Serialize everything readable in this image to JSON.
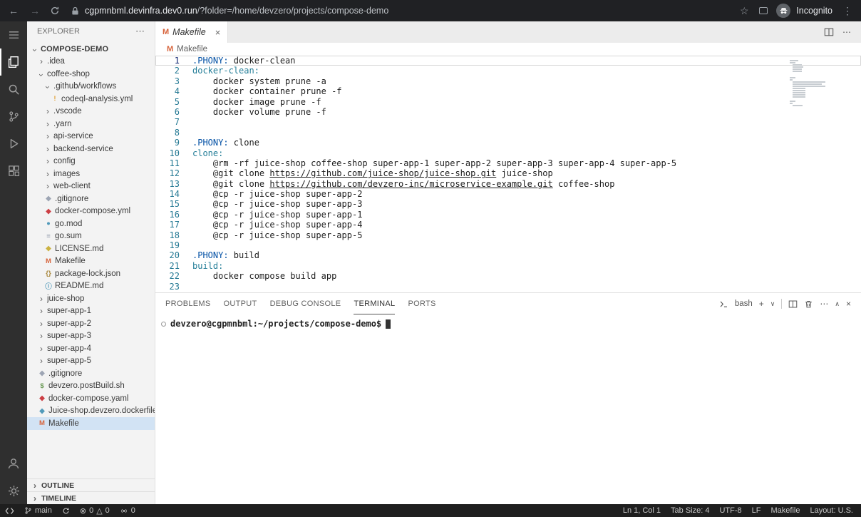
{
  "browser": {
    "url_host": "cgpmnbml.devinfra.dev0.run",
    "url_path": "/?folder=/home/devzero/projects/compose-demo",
    "incognito_label": "Incognito"
  },
  "colors": {
    "makefile_icon": "#d7643c",
    "docker_red": "#cc3e44",
    "docker_blue": "#519aba",
    "selection_background": "#d2e3f4",
    "status_bar_background": "#1f1f1f",
    "keyword": "#0451a5",
    "target": "#267f99"
  },
  "icons": {
    "warning": "!",
    "git": "◆",
    "docker": "◆",
    "dockerfile": "◆",
    "go": "●",
    "gosum": "≡",
    "license": "◆",
    "makefile": "M",
    "json": "{}",
    "info": "ⓘ",
    "shell": "$"
  },
  "sidebar": {
    "header": "EXPLORER",
    "sections": {
      "outline": "OUTLINE",
      "timeline": "TIMELINE"
    },
    "tree": [
      {
        "label": "COMPOSE-DEMO",
        "level": 0,
        "type": "root",
        "expanded": true
      },
      {
        "label": ".idea",
        "level": 1,
        "type": "folder",
        "expanded": false
      },
      {
        "label": "coffee-shop",
        "level": 1,
        "type": "folder",
        "expanded": true
      },
      {
        "label": ".github/workflows",
        "level": 2,
        "type": "folder",
        "expanded": true
      },
      {
        "label": "codeql-analysis.yml",
        "level": 3,
        "type": "file",
        "icon": "warning",
        "color": "#e2a33d"
      },
      {
        "label": ".vscode",
        "level": 2,
        "type": "folder",
        "expanded": false
      },
      {
        "label": ".yarn",
        "level": 2,
        "type": "folder",
        "expanded": false
      },
      {
        "label": "api-service",
        "level": 2,
        "type": "folder",
        "expanded": false
      },
      {
        "label": "backend-service",
        "level": 2,
        "type": "folder",
        "expanded": false
      },
      {
        "label": "config",
        "level": 2,
        "type": "folder",
        "expanded": false
      },
      {
        "label": "images",
        "level": 2,
        "type": "folder",
        "expanded": false
      },
      {
        "label": "web-client",
        "level": 2,
        "type": "folder",
        "expanded": false
      },
      {
        "label": ".gitignore",
        "level": 2,
        "type": "file",
        "icon": "git",
        "color": "#9da5b4"
      },
      {
        "label": "docker-compose.yml",
        "level": 2,
        "type": "file",
        "icon": "docker",
        "color": "#cc3e44"
      },
      {
        "label": "go.mod",
        "level": 2,
        "type": "file",
        "icon": "go",
        "color": "#519aba"
      },
      {
        "label": "go.sum",
        "level": 2,
        "type": "file",
        "icon": "gosum",
        "color": "#9da5b4"
      },
      {
        "label": "LICENSE.md",
        "level": 2,
        "type": "file",
        "icon": "license",
        "color": "#cbb241"
      },
      {
        "label": "Makefile",
        "level": 2,
        "type": "file",
        "icon": "makefile",
        "color": "#d7643c"
      },
      {
        "label": "package-lock.json",
        "level": 2,
        "type": "file",
        "icon": "json",
        "color": "#a8863a"
      },
      {
        "label": "README.md",
        "level": 2,
        "type": "file",
        "icon": "info",
        "color": "#519aba"
      },
      {
        "label": "juice-shop",
        "level": 1,
        "type": "folder",
        "expanded": false
      },
      {
        "label": "super-app-1",
        "level": 1,
        "type": "folder",
        "expanded": false
      },
      {
        "label": "super-app-2",
        "level": 1,
        "type": "folder",
        "expanded": false
      },
      {
        "label": "super-app-3",
        "level": 1,
        "type": "folder",
        "expanded": false
      },
      {
        "label": "super-app-4",
        "level": 1,
        "type": "folder",
        "expanded": false
      },
      {
        "label": "super-app-5",
        "level": 1,
        "type": "folder",
        "expanded": false
      },
      {
        "label": ".gitignore",
        "level": 1,
        "type": "file",
        "icon": "git",
        "color": "#9da5b4"
      },
      {
        "label": "devzero.postBuild.sh",
        "level": 1,
        "type": "file",
        "icon": "shell",
        "color": "#6a9955"
      },
      {
        "label": "docker-compose.yaml",
        "level": 1,
        "type": "file",
        "icon": "docker",
        "color": "#cc3e44"
      },
      {
        "label": "Juice-shop.devzero.dockerfile",
        "level": 1,
        "type": "file",
        "icon": "dockerfile",
        "color": "#519aba"
      },
      {
        "label": "Makefile",
        "level": 1,
        "type": "file",
        "icon": "makefile",
        "color": "#d7643c",
        "selected": true
      }
    ]
  },
  "editor": {
    "tab": {
      "icon": "M",
      "label": "Makefile"
    },
    "breadcrumb": {
      "icon": "M",
      "label": "Makefile"
    },
    "lines": [
      {
        "n": 1,
        "cur": true,
        "s": [
          [
            ".PHONY:",
            "kw"
          ],
          [
            " docker-clean",
            "pl"
          ]
        ]
      },
      {
        "n": 2,
        "s": [
          [
            "docker-clean:",
            "tg"
          ]
        ]
      },
      {
        "n": 3,
        "s": [
          [
            "    docker system prune -a",
            "pl"
          ]
        ]
      },
      {
        "n": 4,
        "s": [
          [
            "    docker container prune -f",
            "pl"
          ]
        ]
      },
      {
        "n": 5,
        "s": [
          [
            "    docker image prune -f",
            "pl"
          ]
        ]
      },
      {
        "n": 6,
        "s": [
          [
            "    docker volume prune -f",
            "pl"
          ]
        ]
      },
      {
        "n": 7,
        "s": []
      },
      {
        "n": 8,
        "s": []
      },
      {
        "n": 9,
        "s": [
          [
            ".PHONY:",
            "kw"
          ],
          [
            " clone",
            "pl"
          ]
        ]
      },
      {
        "n": 10,
        "s": [
          [
            "clone:",
            "tg"
          ]
        ]
      },
      {
        "n": 11,
        "s": [
          [
            "    @rm -rf juice-shop coffee-shop super-app-1 super-app-2 super-app-3 super-app-4 super-app-5",
            "pl"
          ]
        ]
      },
      {
        "n": 12,
        "s": [
          [
            "    @git clone ",
            "pl"
          ],
          [
            "https://github.com/juice-shop/juice-shop.git",
            "ln"
          ],
          [
            " juice-shop",
            "pl"
          ]
        ]
      },
      {
        "n": 13,
        "s": [
          [
            "    @git clone ",
            "pl"
          ],
          [
            "https://github.com/devzero-inc/microservice-example.git",
            "ln"
          ],
          [
            " coffee-shop",
            "pl"
          ]
        ]
      },
      {
        "n": 14,
        "s": [
          [
            "    @cp -r juice-shop super-app-2",
            "pl"
          ]
        ]
      },
      {
        "n": 15,
        "s": [
          [
            "    @cp -r juice-shop super-app-3",
            "pl"
          ]
        ]
      },
      {
        "n": 16,
        "s": [
          [
            "    @cp -r juice-shop super-app-1",
            "pl"
          ]
        ]
      },
      {
        "n": 17,
        "s": [
          [
            "    @cp -r juice-shop super-app-4",
            "pl"
          ]
        ]
      },
      {
        "n": 18,
        "s": [
          [
            "    @cp -r juice-shop super-app-5",
            "pl"
          ]
        ]
      },
      {
        "n": 19,
        "s": []
      },
      {
        "n": 20,
        "s": [
          [
            ".PHONY:",
            "kw"
          ],
          [
            " build",
            "pl"
          ]
        ]
      },
      {
        "n": 21,
        "s": [
          [
            "build:",
            "tg"
          ]
        ]
      },
      {
        "n": 22,
        "s": [
          [
            "    docker compose build app",
            "pl"
          ]
        ]
      },
      {
        "n": 23,
        "s": []
      }
    ]
  },
  "panel": {
    "tabs": [
      {
        "label": "PROBLEMS"
      },
      {
        "label": "OUTPUT"
      },
      {
        "label": "DEBUG CONSOLE"
      },
      {
        "label": "TERMINAL",
        "active": true
      },
      {
        "label": "PORTS"
      }
    ],
    "shell_label": "bash",
    "terminal_prompt": "devzero@cgpmnbml:~/projects/compose-demo$"
  },
  "status_bar": {
    "branch": "main",
    "errors": "0",
    "warnings": "0",
    "ports": "0",
    "right": [
      {
        "name": "cursor-position",
        "label": "Ln 1, Col 1"
      },
      {
        "name": "indentation",
        "label": "Tab Size: 4"
      },
      {
        "name": "encoding",
        "label": "UTF-8"
      },
      {
        "name": "eol",
        "label": "LF"
      },
      {
        "name": "language-mode",
        "label": "Makefile"
      },
      {
        "name": "keyboard-layout",
        "label": "Layout: U.S."
      }
    ]
  }
}
